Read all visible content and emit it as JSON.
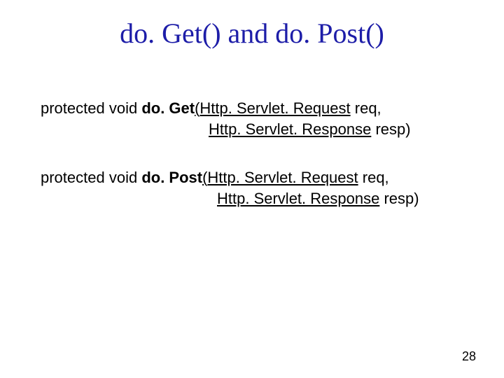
{
  "title": "do. Get() and do. Post()",
  "get": {
    "prefix": "protected void ",
    "method": "do. Get",
    "lparen": "(",
    "reqType": "Http. Servlet. Request",
    "reqVar": " req,",
    "respTypeLead": " ",
    "respType": "Http. Servlet. Response",
    "respVar": " resp)"
  },
  "post": {
    "prefix": "protected void ",
    "method": "do. Post",
    "lparen": "(",
    "reqType": "Http. Servlet. Request",
    "reqVar": " req,",
    "respTypeLead": " ",
    "respType": "Http. Servlet. Response",
    "respVar": " resp)"
  },
  "pageNumber": "28"
}
